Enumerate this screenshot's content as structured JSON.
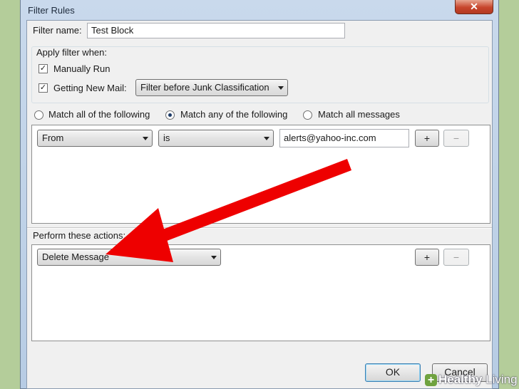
{
  "window": {
    "title": "Filter Rules",
    "close_glyph": "✕"
  },
  "filter_name": {
    "label": "Filter name:",
    "value": "Test Block"
  },
  "apply_when": {
    "label": "Apply filter when:",
    "manually_run": {
      "label": "Manually Run",
      "checked": true
    },
    "getting_new_mail": {
      "label": "Getting New Mail:",
      "checked": true
    },
    "timing_select": "Filter before Junk Classification"
  },
  "match_mode": {
    "options": [
      {
        "label": "Match all of the following",
        "selected": false
      },
      {
        "label": "Match any of the following",
        "selected": true
      },
      {
        "label": "Match all messages",
        "selected": false
      }
    ]
  },
  "condition_row": {
    "field": "From",
    "operator": "is",
    "value": "alerts@yahoo-inc.com",
    "add_label": "+",
    "remove_label": "−"
  },
  "actions": {
    "label": "Perform these actions:",
    "action": "Delete Message",
    "add_label": "+",
    "remove_label": "−"
  },
  "buttons": {
    "ok": "OK",
    "cancel": "Cancel"
  },
  "annotation": {
    "arrow_color": "#ee0000"
  },
  "watermark": {
    "brand_plus": "+",
    "brand_a": "Healthy",
    "brand_b": "Living"
  }
}
